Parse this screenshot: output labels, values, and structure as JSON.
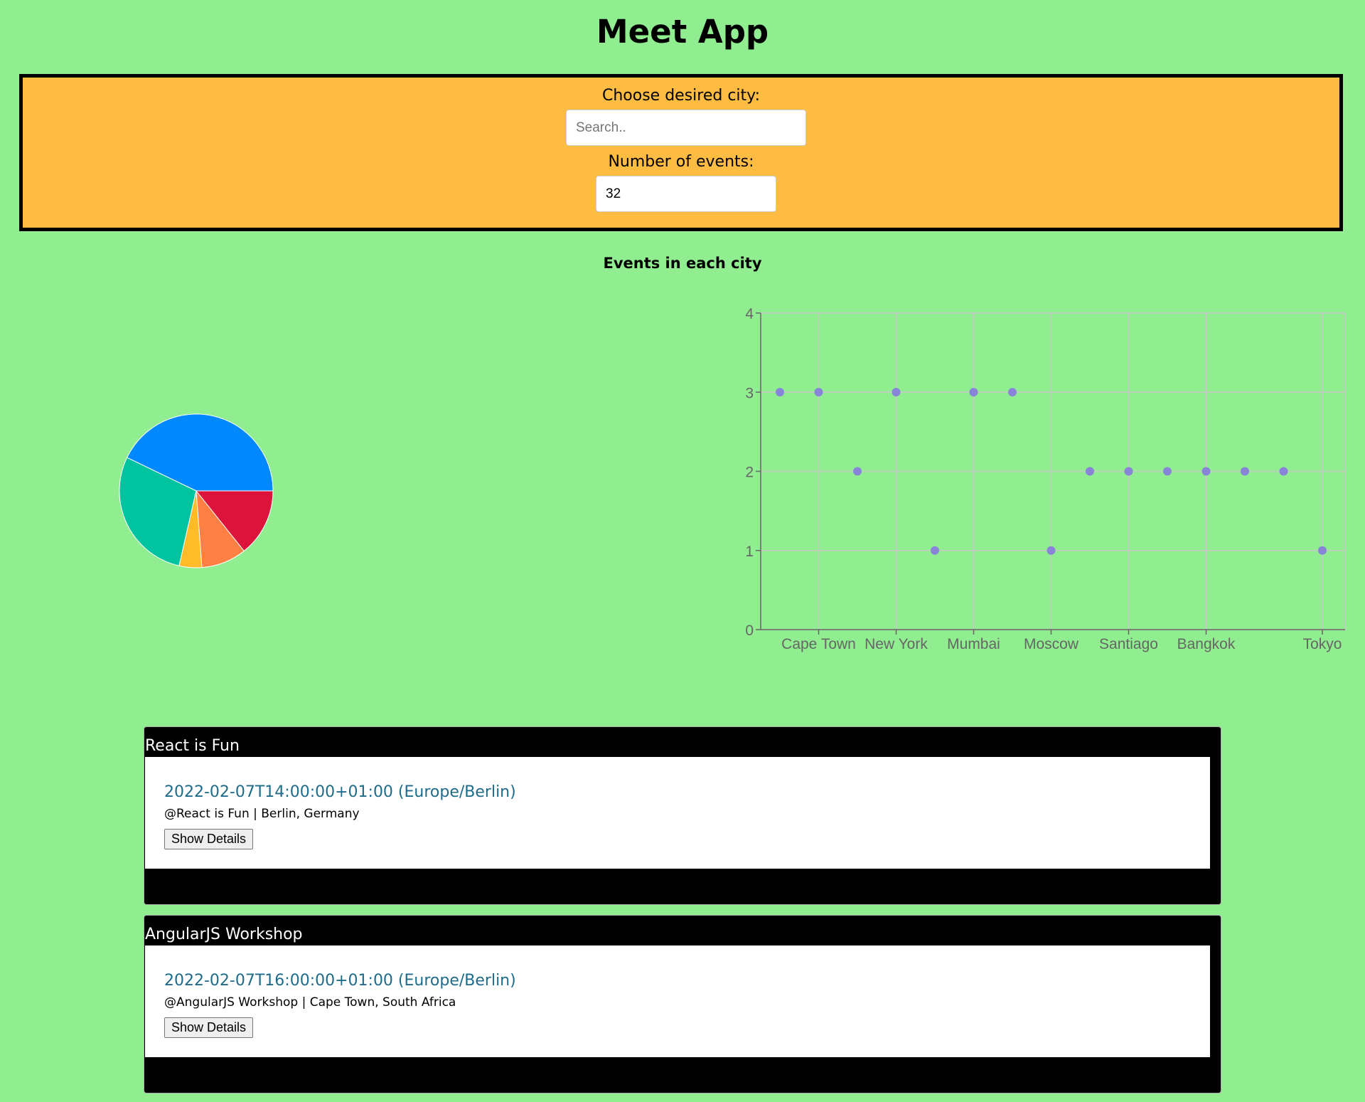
{
  "app": {
    "title": "Meet App"
  },
  "filters": {
    "city_label": "Choose desired city:",
    "city_placeholder": "Search..",
    "city_value": "",
    "number_label": "Number of events:",
    "number_value": "32"
  },
  "charts_title": "Events in each city",
  "colors": {
    "background": "#90ee90",
    "filter_panel": "#ffbc42",
    "scatter_point": "#8884d8",
    "event_link": "#1e6b8a"
  },
  "chart_data": [
    {
      "type": "pie",
      "slices": [
        {
          "value": 9,
          "color": "#0088fe"
        },
        {
          "value": 6,
          "color": "#00c49f"
        },
        {
          "value": 1,
          "color": "#ffbb28"
        },
        {
          "value": 2,
          "color": "#ff8042"
        },
        {
          "value": 3,
          "color": "#dc143c"
        }
      ]
    },
    {
      "type": "scatter",
      "ylim": [
        0,
        4
      ],
      "yticks": [
        0,
        1,
        2,
        3,
        4
      ],
      "grid": true,
      "tick_labels": [
        "Cape Town",
        "New York",
        "Mumbai",
        "Moscow",
        "Santiago",
        "Bangkok",
        "Tokyo"
      ],
      "tick_positions": [
        1,
        3,
        5,
        7,
        9,
        11,
        14
      ],
      "points": [
        3,
        3,
        2,
        3,
        1,
        3,
        3,
        1,
        2,
        2,
        2,
        2,
        2,
        2,
        1
      ]
    }
  ],
  "events": [
    {
      "summary": "React is Fun",
      "start": "2022-02-07T14:00:00+01:00 (Europe/Berlin)",
      "location": "@React is Fun | Berlin, Germany",
      "button_label": "Show Details"
    },
    {
      "summary": "AngularJS Workshop",
      "start": "2022-02-07T16:00:00+01:00 (Europe/Berlin)",
      "location": "@AngularJS Workshop | Cape Town, South Africa",
      "button_label": "Show Details"
    }
  ]
}
